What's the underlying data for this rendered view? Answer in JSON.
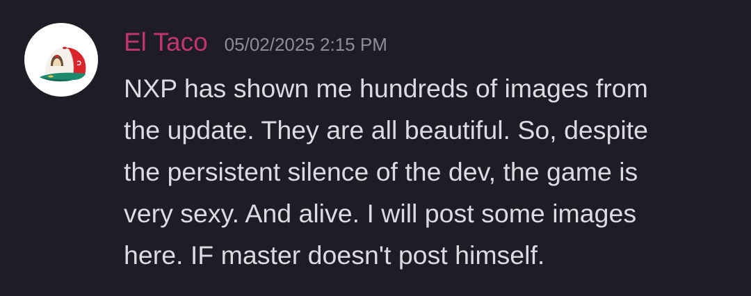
{
  "message": {
    "author": {
      "name": "El Taco",
      "name_color": "#c2366b",
      "avatar_icon": "baseball-cap-avatar"
    },
    "timestamp": "05/02/2025 2:15 PM",
    "content_lines": [
      "NXP has shown me hundreds of images from",
      "the update. They are all beautiful. So, despite",
      "the persistent silence of the dev, the game is",
      "very sexy. And alive. I will post some images",
      "here. IF master doesn't post himself."
    ]
  },
  "colors": {
    "background": "#1e1d26",
    "text": "#dbdbe0",
    "timestamp": "#8e8e98"
  }
}
